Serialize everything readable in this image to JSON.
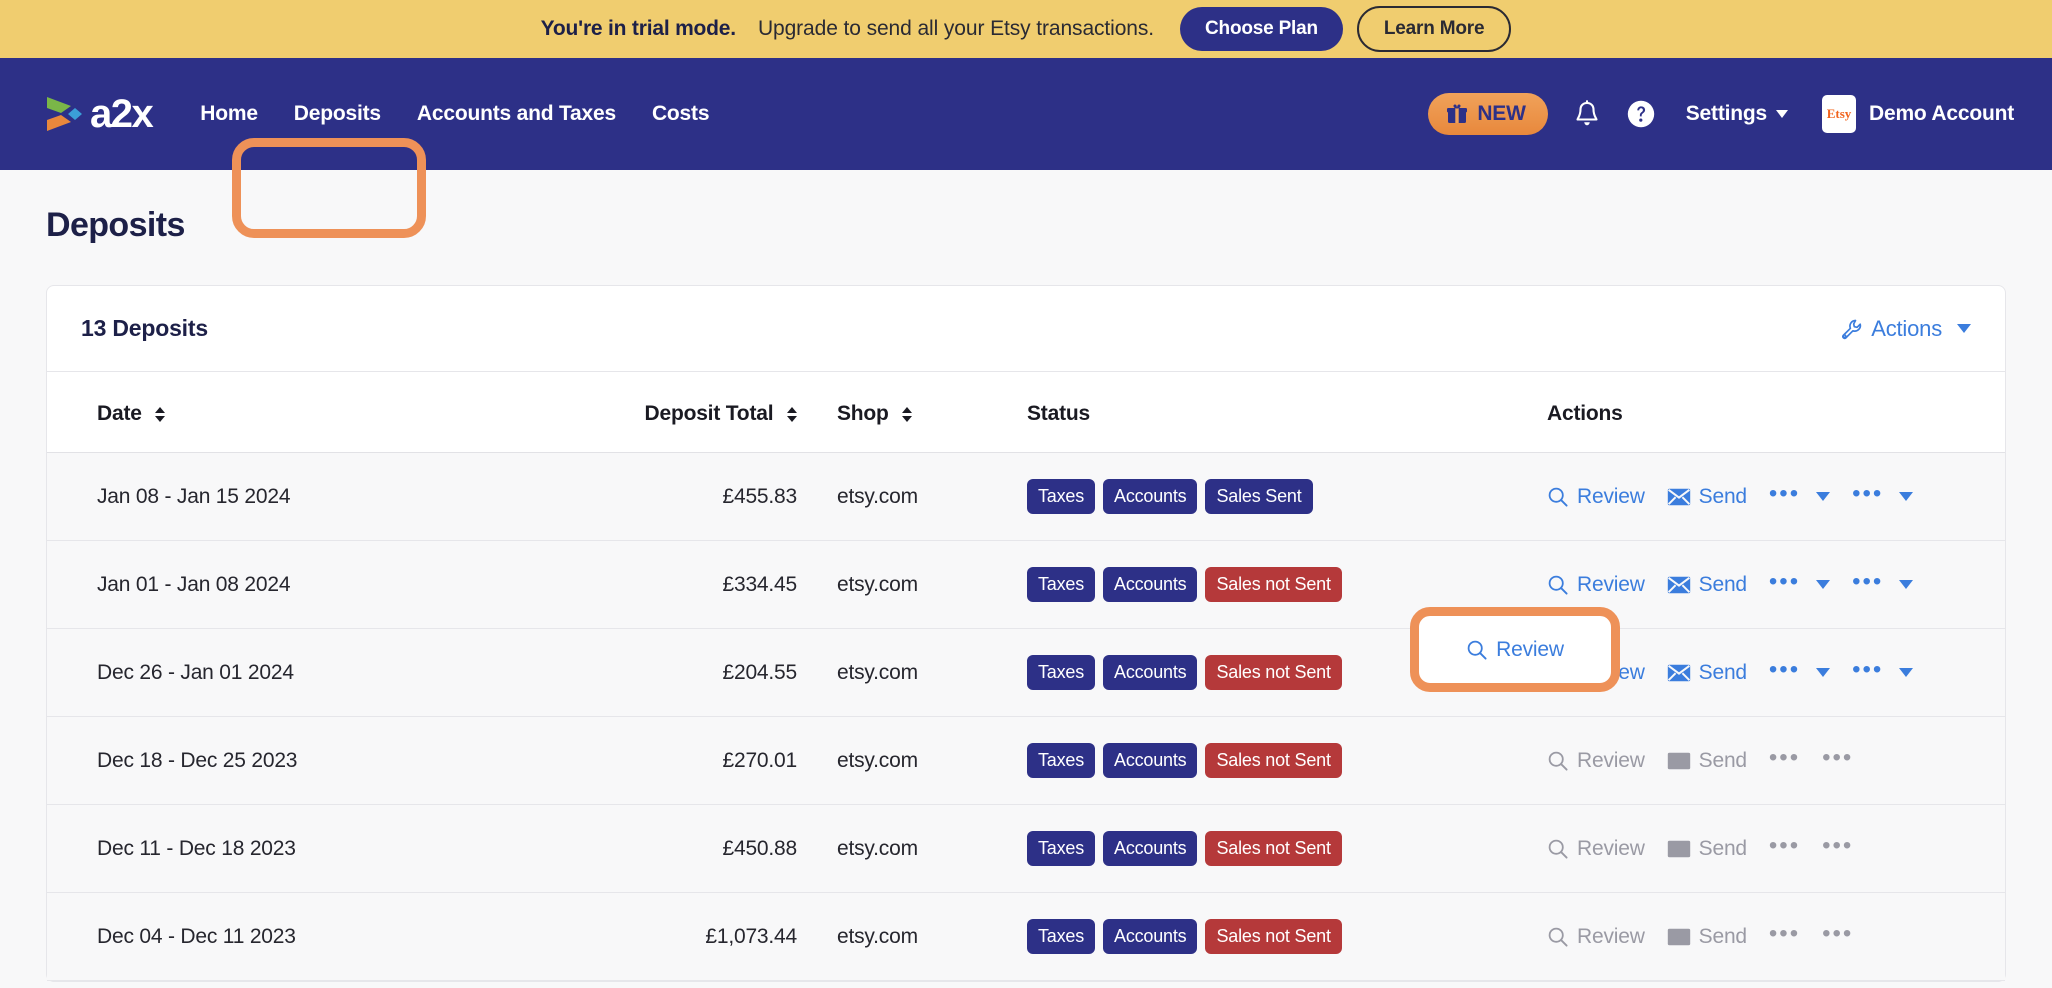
{
  "trial_banner": {
    "strong_text": "You're in trial mode.",
    "message": "Upgrade to send all your Etsy transactions.",
    "choose_plan_label": "Choose Plan",
    "learn_more_label": "Learn More",
    "background_color": "#f0cd6f"
  },
  "navbar": {
    "logo_text": "a2x",
    "background_color": "#2d3087",
    "links": [
      {
        "label": "Home"
      },
      {
        "label": "Deposits"
      },
      {
        "label": "Accounts and Taxes"
      },
      {
        "label": "Costs"
      }
    ],
    "new_badge": {
      "label": "NEW",
      "icon": "gift-icon"
    },
    "notifications_icon": "bell-icon",
    "help_icon": "question-circle-icon",
    "settings_label": "Settings",
    "account": {
      "marketplace": "Etsy",
      "name": "Demo Account"
    }
  },
  "page": {
    "title": "Deposits"
  },
  "card": {
    "count_label": "13 Deposits",
    "actions_label": "Actions",
    "actions_icon": "wrench-icon"
  },
  "table": {
    "columns": [
      {
        "label": "Date",
        "sortable": true
      },
      {
        "label": "Deposit Total",
        "sortable": true
      },
      {
        "label": "Shop",
        "sortable": true
      },
      {
        "label": "Status",
        "sortable": false
      },
      {
        "label": "Actions",
        "sortable": false
      }
    ],
    "action_labels": {
      "review": "Review",
      "send": "Send",
      "more": "•••"
    },
    "rows": [
      {
        "date": "Jan 08 - Jan 15 2024",
        "total": "£455.83",
        "shop": "etsy.com",
        "badges": [
          {
            "label": "Taxes",
            "color": "navy"
          },
          {
            "label": "Accounts",
            "color": "navy"
          },
          {
            "label": "Sales Sent",
            "color": "navy"
          }
        ],
        "enabled": true
      },
      {
        "date": "Jan 01 - Jan 08 2024",
        "total": "£334.45",
        "shop": "etsy.com",
        "badges": [
          {
            "label": "Taxes",
            "color": "navy"
          },
          {
            "label": "Accounts",
            "color": "navy"
          },
          {
            "label": "Sales not Sent",
            "color": "red"
          }
        ],
        "enabled": true
      },
      {
        "date": "Dec 26 - Jan 01 2024",
        "total": "£204.55",
        "shop": "etsy.com",
        "badges": [
          {
            "label": "Taxes",
            "color": "navy"
          },
          {
            "label": "Accounts",
            "color": "navy"
          },
          {
            "label": "Sales not Sent",
            "color": "red"
          }
        ],
        "enabled": true
      },
      {
        "date": "Dec 18 - Dec 25 2023",
        "total": "£270.01",
        "shop": "etsy.com",
        "badges": [
          {
            "label": "Taxes",
            "color": "navy"
          },
          {
            "label": "Accounts",
            "color": "navy"
          },
          {
            "label": "Sales not Sent",
            "color": "red"
          }
        ],
        "enabled": false
      },
      {
        "date": "Dec 11 - Dec 18 2023",
        "total": "£450.88",
        "shop": "etsy.com",
        "badges": [
          {
            "label": "Taxes",
            "color": "navy"
          },
          {
            "label": "Accounts",
            "color": "navy"
          },
          {
            "label": "Sales not Sent",
            "color": "red"
          }
        ],
        "enabled": false
      },
      {
        "date": "Dec 04 - Dec 11 2023",
        "total": "£1,073.44",
        "shop": "etsy.com",
        "badges": [
          {
            "label": "Taxes",
            "color": "navy"
          },
          {
            "label": "Accounts",
            "color": "navy"
          },
          {
            "label": "Sales not Sent",
            "color": "red"
          }
        ],
        "enabled": false
      }
    ]
  },
  "annotations": {
    "highlight_color": "#ee9158",
    "targets": [
      "nav-deposits",
      "row2-review-button"
    ]
  }
}
